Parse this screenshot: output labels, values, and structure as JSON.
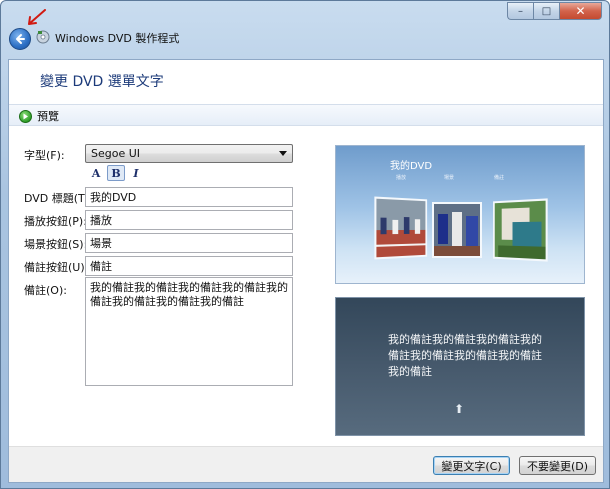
{
  "window": {
    "app_title": "Windows DVD 製作程式",
    "minimize": "–",
    "maximize": "□",
    "close": "✕"
  },
  "page": {
    "title": "變更 DVD 選單文字"
  },
  "toolbar": {
    "preview_label": "預覽"
  },
  "form": {
    "font_label": "字型(F):",
    "font_value": "Segoe UI",
    "style_a": "A",
    "style_b": "B",
    "style_i": "I",
    "dvd_title_label": "DVD 標題(T):",
    "dvd_title_value": "我的DVD",
    "play_button_label": "播放按鈕(P):",
    "play_button_value": "播放",
    "scene_button_label": "場景按鈕(S):",
    "scene_button_value": "場景",
    "notes_button_label": "備註按鈕(U):",
    "notes_button_value": "備註",
    "notes_label": "備註(O):",
    "notes_value": "我的備註我的備註我的備註我的備註我的備註我的備註我的備註我的備註"
  },
  "preview_menu": {
    "title": "我的DVD",
    "thumb_labels": [
      "播放",
      "場景",
      "備註"
    ]
  },
  "preview_notes": {
    "text": "我的備註我的備註我的備註我的備註我的備註我的備註我的備註我的備註"
  },
  "footer": {
    "change_text_button": "變更文字(C)",
    "dont_change_button": "不要變更(D)"
  },
  "colors": {
    "title_blue": "#1d3b7a",
    "preview_dark": "#3a4e62"
  }
}
